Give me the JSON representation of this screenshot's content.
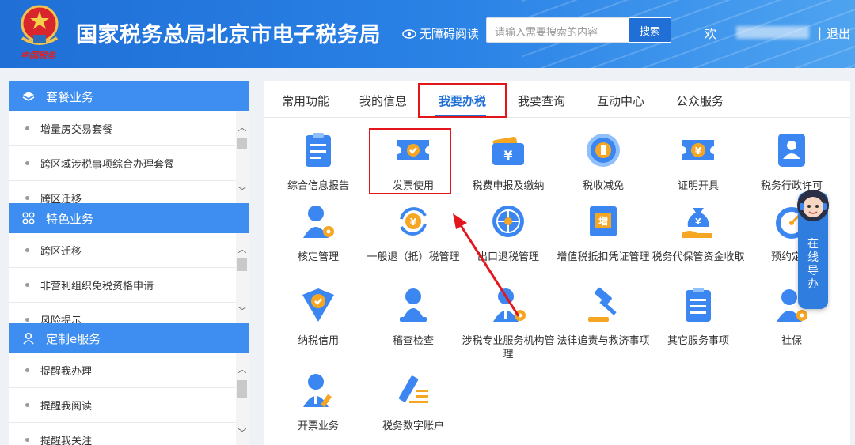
{
  "header": {
    "emblem_caption": "中国税务",
    "title": "国家税务总局北京市电子税务局",
    "a11y_label": "无障碍阅读",
    "search_placeholder": "请输入需要搜索的内容",
    "search_button": "搜索",
    "welcome": "欢",
    "divider": "|",
    "logout": "退出"
  },
  "sidebar": {
    "sections": [
      {
        "title": "套餐业务",
        "icon": "layers-icon",
        "items": [
          "增量房交易套餐",
          "跨区域涉税事项综合办理套餐",
          "跨区迁移"
        ]
      },
      {
        "title": "特色业务",
        "icon": "grid-icon",
        "items": [
          "跨区迁移",
          "非营利组织免税资格申请",
          "风险提示"
        ]
      },
      {
        "title": "定制e服务",
        "icon": "user-icon",
        "items": [
          "提醒我办理",
          "提醒我阅读",
          "提醒我关注"
        ]
      }
    ]
  },
  "tabs": [
    "常用功能",
    "我的信息",
    "我要办税",
    "我要查询",
    "互动中心",
    "公众服务"
  ],
  "active_tab": "我要办税",
  "grid": [
    {
      "label": "综合信息报告",
      "icon": "report-icon"
    },
    {
      "label": "发票使用",
      "icon": "invoice-check-icon"
    },
    {
      "label": "税费申报及缴纳",
      "icon": "wallet-yuan-icon"
    },
    {
      "label": "税收减免",
      "icon": "tax-coin-icon"
    },
    {
      "label": "证明开具",
      "icon": "ticket-yuan-icon"
    },
    {
      "label": "税务行政许可",
      "icon": "license-person-icon"
    },
    {
      "label": "核定管理",
      "icon": "person-gear-icon"
    },
    {
      "label": "一般退（抵）税管理",
      "icon": "refund-cycle-icon"
    },
    {
      "label": "出口退税管理",
      "icon": "globe-icon"
    },
    {
      "label": "增值税抵扣凭证管理",
      "icon": "vat-voucher-icon"
    },
    {
      "label": "税务代保管资金收取",
      "icon": "money-bag-hand-icon"
    },
    {
      "label": "预约定价",
      "icon": "gauge-icon"
    },
    {
      "label": "纳税信用",
      "icon": "credit-shield-icon"
    },
    {
      "label": "稽查检查",
      "icon": "inspector-stamp-icon"
    },
    {
      "label": "涉税专业服务机构管理",
      "icon": "agent-gear-icon"
    },
    {
      "label": "法律追责与救济事项",
      "icon": "gavel-icon"
    },
    {
      "label": "其它服务事项",
      "icon": "clipboard-icon"
    },
    {
      "label": "社保",
      "icon": "person-gear-icon"
    },
    {
      "label": "开票业务",
      "icon": "agent-pen-icon"
    },
    {
      "label": "税务数字账户",
      "icon": "pen-lines-icon"
    }
  ],
  "assistant": {
    "label": "在线导办",
    "icon": "support-agent-icon"
  },
  "colors": {
    "header_blue": "#1f6fd6",
    "accent_blue": "#3d8ef0",
    "highlight_red": "#e3161b",
    "icon_blue": "#3b86f0",
    "icon_orange": "#f5a623"
  }
}
